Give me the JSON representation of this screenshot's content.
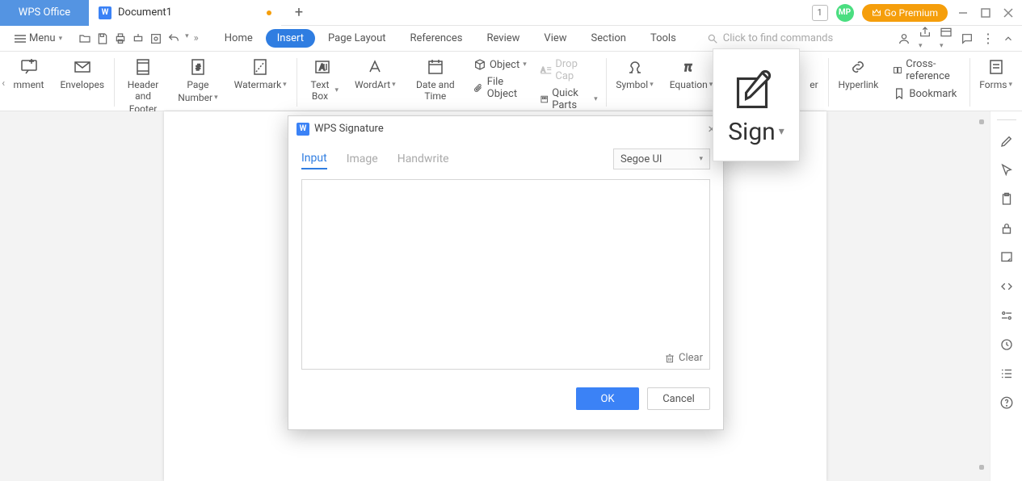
{
  "titlebar": {
    "app_tab": "WPS Office",
    "doc_tab": "Document1",
    "doc_icon_letter": "W",
    "badge": "1",
    "avatar": "MP",
    "premium": "Go Premium"
  },
  "menubar": {
    "menu": "Menu",
    "tabs": {
      "home": "Home",
      "insert": "Insert",
      "page_layout": "Page Layout",
      "references": "References",
      "review": "Review",
      "view": "View",
      "section": "Section",
      "tools": "Tools"
    },
    "search_placeholder": "Click to find commands"
  },
  "ribbon": {
    "comment": "mment",
    "envelopes": "Envelopes",
    "header_footer_l1": "Header and",
    "header_footer_l2": "Footer",
    "page_number_l1": "Page",
    "page_number_l2": "Number",
    "watermark": "Watermark",
    "text_box": "Text Box",
    "wordart": "WordArt",
    "date_time": "Date and Time",
    "object": "Object",
    "drop_cap": "Drop Cap",
    "file_object": "File Object",
    "quick_parts": "Quick Parts",
    "symbol": "Symbol",
    "equation": "Equation",
    "er_partial": "er",
    "hyperlink": "Hyperlink",
    "cross_ref": "Cross-reference",
    "bookmark": "Bookmark",
    "forms": "Forms"
  },
  "dialog": {
    "title": "WPS Signature",
    "icon_letter": "W",
    "tabs": {
      "input": "Input",
      "image": "Image",
      "handwrite": "Handwrite"
    },
    "font": "Segoe UI",
    "clear": "Clear",
    "ok": "OK",
    "cancel": "Cancel"
  },
  "sign_tip": {
    "label": "Sign"
  }
}
